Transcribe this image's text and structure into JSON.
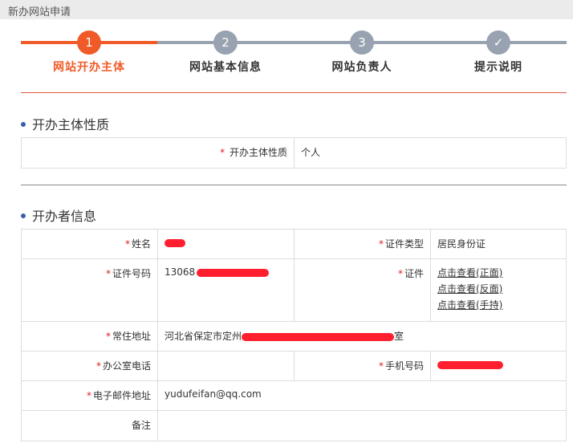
{
  "title": "新办网站申请",
  "steps": [
    {
      "number": "1",
      "label": "网站开办主体"
    },
    {
      "number": "2",
      "label": "网站基本信息"
    },
    {
      "number": "3",
      "label": "网站负责人"
    },
    {
      "number": "✓",
      "label": "提示说明"
    }
  ],
  "active_step": 1,
  "section1": {
    "title": "开办主体性质",
    "label": "开办主体性质",
    "value": "个人"
  },
  "section2": {
    "title": "开办者信息",
    "fields": {
      "name_label": "姓名",
      "id_type_label": "证件类型",
      "id_type_value": "居民身份证",
      "id_no_label": "证件号码",
      "id_no_prefix": "13068",
      "cert_label": "证件",
      "cert_links": [
        "点击查看(正面)",
        "点击查看(反面)",
        "点击查看(手持)"
      ],
      "address_label": "常住地址",
      "address_prefix": "河北省保定市定州",
      "address_suffix": "室",
      "office_phone_label": "办公室电话",
      "office_phone_value": "",
      "mobile_label": "手机号码",
      "email_label": "电子邮件地址",
      "email_value": "yudufeifan@qq.com",
      "remark_label": "备注",
      "remark_value": ""
    }
  },
  "colors": {
    "accent": "#f05a28",
    "inactive": "#98a2b0",
    "required": "#e02020",
    "redaction": "#ff1f2f"
  }
}
